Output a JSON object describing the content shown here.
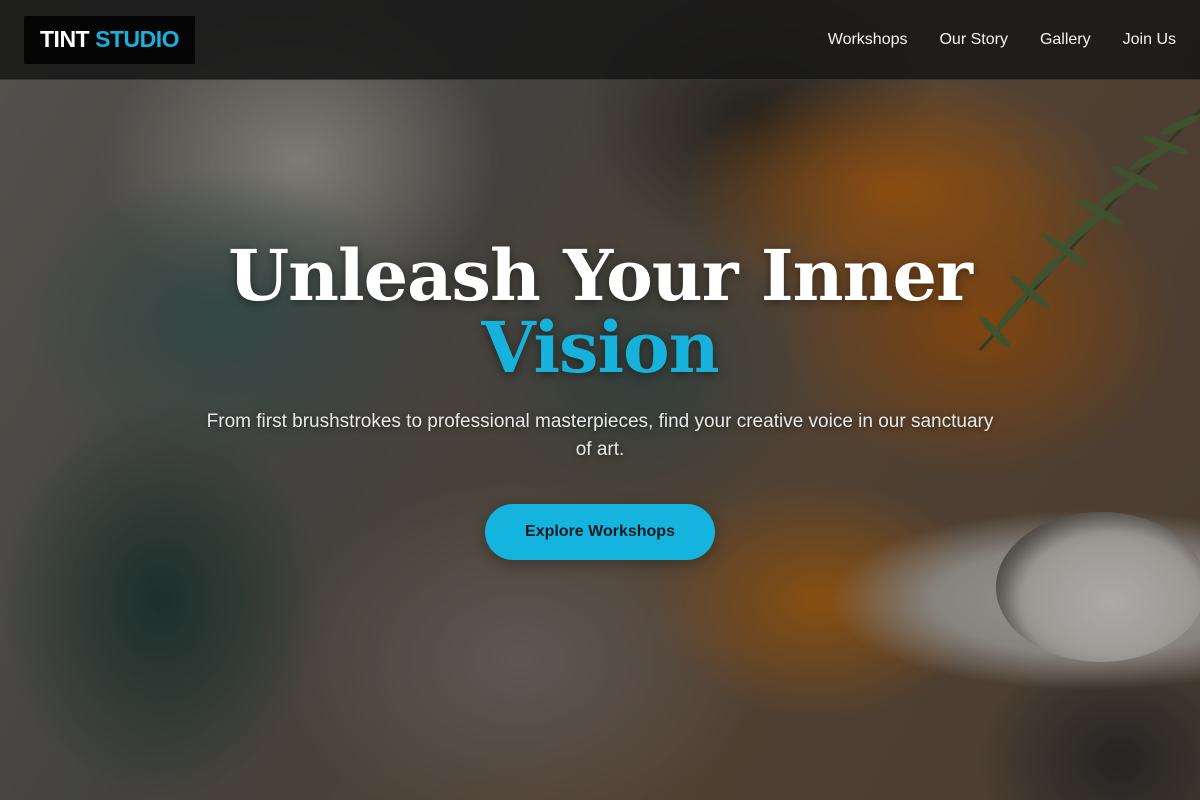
{
  "header": {
    "logo": {
      "part1": "TINT",
      "part2": "STUDIO"
    },
    "nav": [
      "Workshops",
      "Our Story",
      "Gallery",
      "Join Us"
    ]
  },
  "hero": {
    "headline_line1": "Unleash Your Inner",
    "headline_accent": "Vision",
    "subtitle": "From first brushstrokes to professional masterpieces, find your creative voice in our sanctuary of art.",
    "cta_label": "Explore Workshops",
    "background": "painted-palette-image"
  },
  "colors": {
    "accent": "#16b2db",
    "header_bg": "#181818",
    "text": "#ffffff"
  }
}
